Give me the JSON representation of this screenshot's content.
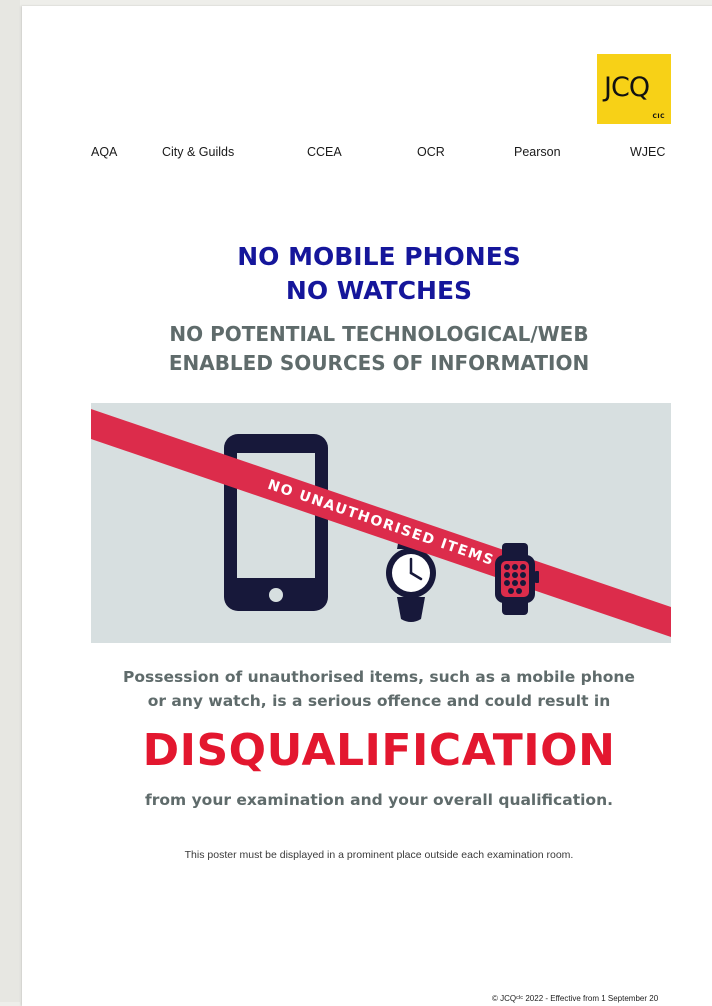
{
  "logo": {
    "text": "JCQ",
    "suffix": "CIC",
    "color": "#f7d117"
  },
  "awarding_bodies": [
    "AQA",
    "City & Guilds",
    "CCEA",
    "OCR",
    "Pearson",
    "WJEC"
  ],
  "headings": {
    "line1": "NO MOBILE PHONES",
    "line2": "NO WATCHES",
    "sub_line1": "NO POTENTIAL TECHNOLOGICAL/WEB",
    "sub_line2": "ENABLED SOURCES OF INFORMATION"
  },
  "graphic": {
    "banner_text": "NO UNAUTHORISED ITEMS",
    "banner_color": "#dc2c4b",
    "icons": [
      "mobile-phone-icon",
      "analogue-watch-icon",
      "smartwatch-icon"
    ]
  },
  "warning": {
    "line1": "Possession of unauthorised items, such as a mobile phone",
    "line2": "or any watch, is a serious offence and could result in",
    "highlight": "DISQUALIFICATION",
    "line3": "from your examination and your overall qualification."
  },
  "note": "This poster must be displayed in a prominent place outside each examination room.",
  "copyright": "© JCQᶜᴵᶜ 2022 - Effective from 1 September 20",
  "colors": {
    "heading_blue": "#15169b",
    "heading_grey": "#5f6b6b",
    "alert_red": "#e3172f",
    "panel_bg": "#d7dfe0"
  }
}
